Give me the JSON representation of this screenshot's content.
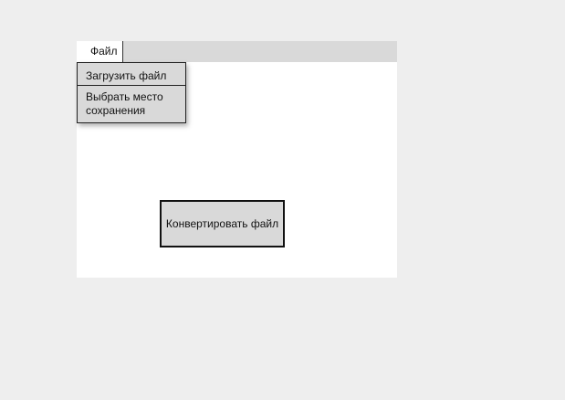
{
  "menubar": {
    "file_label": "Файл"
  },
  "file_menu": {
    "items": [
      {
        "label": "Загрузить файл"
      },
      {
        "label": "Выбрать место\nсохранения"
      }
    ]
  },
  "main": {
    "convert_button_label": "Конвертировать файл"
  },
  "colors": {
    "background": "#eeeeee",
    "window": "#ffffff",
    "menubar": "#d9d9d9",
    "control": "#d9d9d9",
    "border": "#111111"
  }
}
